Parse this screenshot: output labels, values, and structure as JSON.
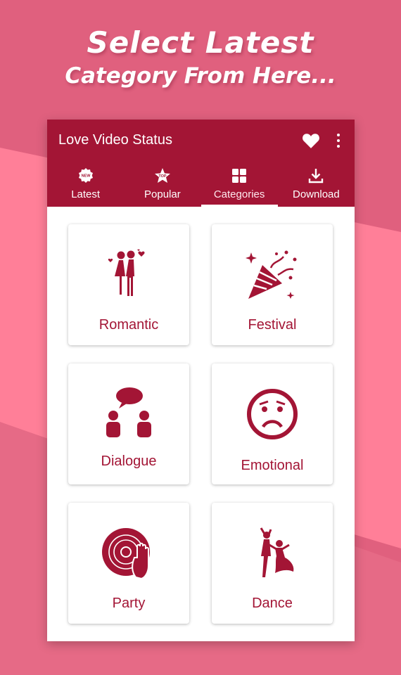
{
  "promo": {
    "line1": "Select Latest",
    "line2": "Category From Here..."
  },
  "app": {
    "title": "Love Video Status"
  },
  "tabs": [
    {
      "label": "Latest",
      "icon": "new-badge-icon"
    },
    {
      "label": "Popular",
      "icon": "top-star-icon"
    },
    {
      "label": "Categories",
      "icon": "grid-icon",
      "active": true
    },
    {
      "label": "Download",
      "icon": "download-icon"
    }
  ],
  "categories": [
    {
      "label": "Romantic",
      "icon": "couple-icon"
    },
    {
      "label": "Festival",
      "icon": "party-popper-icon"
    },
    {
      "label": "Dialogue",
      "icon": "conversation-icon"
    },
    {
      "label": "Emotional",
      "icon": "sad-face-icon"
    },
    {
      "label": "Party",
      "icon": "dj-disc-icon"
    },
    {
      "label": "Dance",
      "icon": "dancing-couple-icon"
    }
  ],
  "colors": {
    "primary": "#a31535",
    "background": "#e0607e",
    "accent_light": "#ff7f98"
  }
}
